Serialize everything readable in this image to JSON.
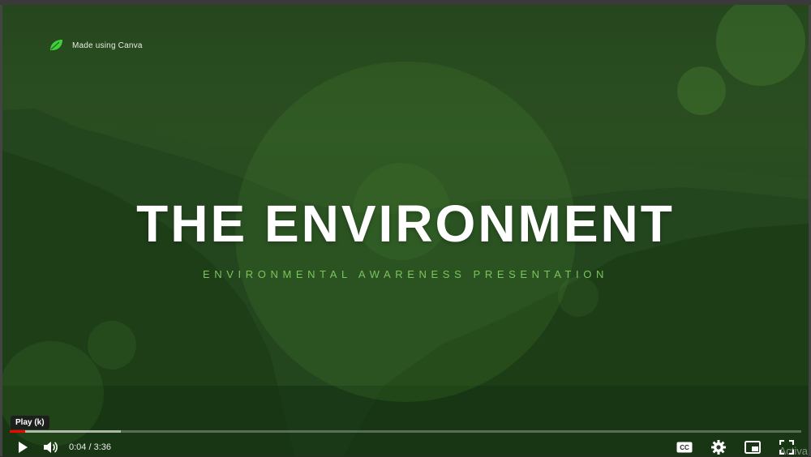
{
  "badge": {
    "text": "Made using Canva",
    "icon": "leaf-icon",
    "icon_color": "#3fd13a"
  },
  "slide": {
    "title": "THE ENVIRONMENT",
    "subtitle": "ENVIRONMENTAL AWARENESS PRESENTATION"
  },
  "player": {
    "tooltip": "Play (k)",
    "current_time": "0:04",
    "duration": "3:36",
    "time_display": "0:04 / 3:36",
    "played_fraction": 0.019,
    "loaded_fraction": 0.14,
    "progress_color": "#ff0000",
    "left_controls": [
      "play-icon",
      "volume-icon"
    ],
    "right_controls": [
      "closed-captions-icon",
      "settings-gear-icon",
      "miniplayer-icon",
      "fullscreen-icon"
    ]
  },
  "watermark": "Activa",
  "colors": {
    "title": "#ffffff",
    "subtitle": "#7ac55a",
    "overlay_green": "#2d4d22"
  }
}
